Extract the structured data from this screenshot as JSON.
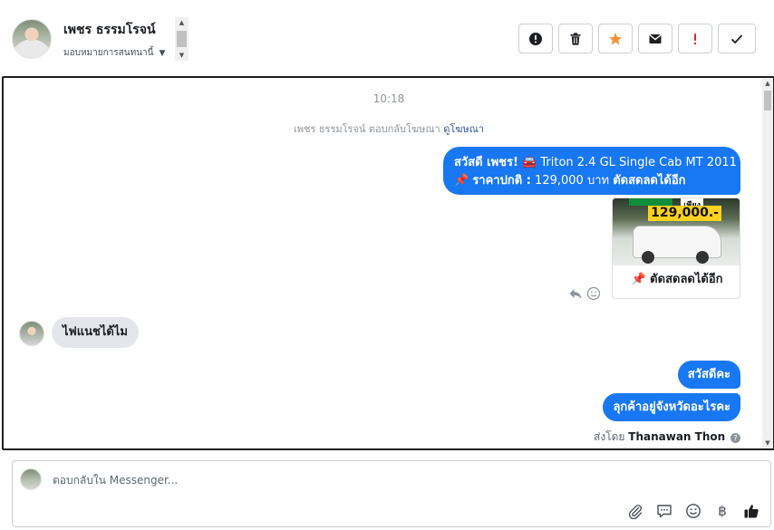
{
  "header": {
    "contact_name": "เพชร ธรรมโรจน์",
    "assign_label": "มอบหมายการสนทนานี้",
    "actions": [
      {
        "icon": "alert-circle-icon",
        "color": "#1c1e21"
      },
      {
        "icon": "trash-icon",
        "color": "#1c1e21"
      },
      {
        "icon": "star-icon",
        "color": "#f7923b"
      },
      {
        "icon": "envelope-icon",
        "color": "#1c1e21"
      },
      {
        "icon": "exclamation-icon",
        "color": "#e02424"
      },
      {
        "icon": "checkmark-icon",
        "color": "#1c1e21"
      }
    ]
  },
  "chat": {
    "timestamp": "10:18",
    "reply_notice": "เพชร ธรรมโรจน์ ตอบกลับโฆษณา",
    "ad_link": "ดูโฆษณา",
    "outgoing_1_line1_bold": "สวัสดี เพชร!",
    "outgoing_1_line1_text": "Triton 2.4 GL Single Cab MT 2011",
    "outgoing_1_line2_bold": "ราคาปกติ :",
    "outgoing_1_line2_text": "129,000 บาท",
    "outgoing_1_line2_tail": "ตัดสดลดได้อีก",
    "card": {
      "price_badge": "129,000.-",
      "only_label": "เพียง",
      "caption": "📌 ตัดสดลดได้อีก"
    },
    "incoming_1": "ไฟแนชได้ไม",
    "outgoing_2": "สวัสดีคะ",
    "outgoing_3": "ลุกค้าอยู่จังหวัดอะไรคะ",
    "sent_by_label": "ส่งโดย",
    "sent_by_name": "Thanawan Thon",
    "bubble_color": "#1877f2"
  },
  "composer": {
    "placeholder": "ตอบกลับใน Messenger...",
    "tools": [
      "paperclip-icon",
      "speech-bubble-icon",
      "smiley-icon",
      "baht-icon",
      "thumbs-up-icon"
    ]
  }
}
